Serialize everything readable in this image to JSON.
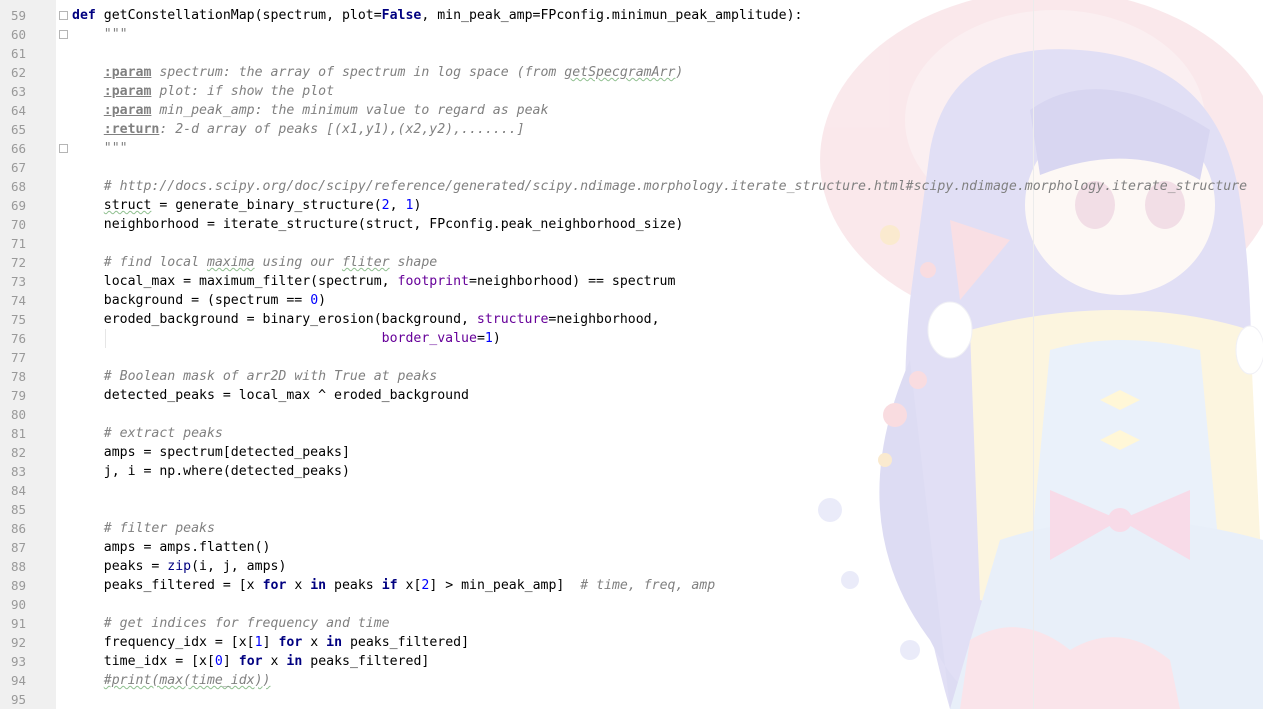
{
  "editor": {
    "line_numbers": [
      "59",
      "60",
      "61",
      "62",
      "63",
      "64",
      "65",
      "66",
      "67",
      "68",
      "69",
      "70",
      "71",
      "72",
      "73",
      "74",
      "75",
      "76",
      "77",
      "78",
      "79",
      "80",
      "81",
      "82",
      "83",
      "84",
      "85",
      "86",
      "87",
      "88",
      "89",
      "90",
      "91",
      "92",
      "93",
      "94",
      "95"
    ],
    "lines": [
      [
        {
          "t": "def",
          "c": "kw"
        },
        {
          "t": " getConstellationMap(spectrum, plot="
        },
        {
          "t": "False",
          "c": "kw"
        },
        {
          "t": ", min_peak_amp=FPconfig.minimun_peak_amplitude):"
        }
      ],
      [
        {
          "t": "    \"\"\"",
          "c": "doc"
        }
      ],
      [],
      [
        {
          "t": "    "
        },
        {
          "t": ":param",
          "c": "tag"
        },
        {
          "t": " spectrum: the array of spectrum in log space (from ",
          "c": "doc"
        },
        {
          "t": "getSpecgramArr",
          "c": "doc squig"
        },
        {
          "t": ")",
          "c": "doc"
        }
      ],
      [
        {
          "t": "    "
        },
        {
          "t": ":param",
          "c": "tag"
        },
        {
          "t": " plot: if show the plot",
          "c": "doc"
        }
      ],
      [
        {
          "t": "    "
        },
        {
          "t": ":param",
          "c": "tag"
        },
        {
          "t": " min_peak_amp: the minimum value to regard as peak",
          "c": "doc"
        }
      ],
      [
        {
          "t": "    "
        },
        {
          "t": ":return",
          "c": "tag"
        },
        {
          "t": ": 2-d array of peaks [(x1,y1),(x2,y2),.......]",
          "c": "doc"
        }
      ],
      [
        {
          "t": "    \"\"\"",
          "c": "doc"
        }
      ],
      [],
      [
        {
          "t": "    "
        },
        {
          "t": "# http://docs.scipy.org/doc/scipy/reference/generated/scipy.ndimage.morphology.iterate_structure.html#scipy.ndimage.morphology.iterate_structure",
          "c": "cm"
        }
      ],
      [
        {
          "t": "    "
        },
        {
          "t": "struct",
          "c": "squig"
        },
        {
          "t": " = generate_binary_structure("
        },
        {
          "t": "2",
          "c": "num"
        },
        {
          "t": ", "
        },
        {
          "t": "1",
          "c": "num"
        },
        {
          "t": ")"
        }
      ],
      [
        {
          "t": "    neighborhood = iterate_structure(struct, FPconfig.peak_neighborhood_size)"
        }
      ],
      [],
      [
        {
          "t": "    "
        },
        {
          "t": "# find local ",
          "c": "cm"
        },
        {
          "t": "maxima",
          "c": "cm squig"
        },
        {
          "t": " using our ",
          "c": "cm"
        },
        {
          "t": "fliter",
          "c": "cm squig"
        },
        {
          "t": " shape",
          "c": "cm"
        }
      ],
      [
        {
          "t": "    local_max = maximum_filter(spectrum, "
        },
        {
          "t": "footprint",
          "c": "kwarg"
        },
        {
          "t": "=neighborhood) == spectrum"
        }
      ],
      [
        {
          "t": "    background = (spectrum == "
        },
        {
          "t": "0",
          "c": "num"
        },
        {
          "t": ")"
        }
      ],
      [
        {
          "t": "    eroded_background = binary_erosion(background, "
        },
        {
          "t": "structure",
          "c": "kwarg"
        },
        {
          "t": "=neighborhood,"
        }
      ],
      [
        {
          "t": "                                       "
        },
        {
          "t": "border_value",
          "c": "kwarg"
        },
        {
          "t": "="
        },
        {
          "t": "1",
          "c": "num"
        },
        {
          "t": ")"
        }
      ],
      [],
      [
        {
          "t": "    "
        },
        {
          "t": "# Boolean mask of arr2D with True at peaks",
          "c": "cm"
        }
      ],
      [
        {
          "t": "    detected_peaks = local_max ^ eroded_background"
        }
      ],
      [],
      [
        {
          "t": "    "
        },
        {
          "t": "# extract peaks",
          "c": "cm"
        }
      ],
      [
        {
          "t": "    amps = spectrum[detected_peaks]"
        }
      ],
      [
        {
          "t": "    j, i = np.where(detected_peaks)"
        }
      ],
      [],
      [],
      [
        {
          "t": "    "
        },
        {
          "t": "# filter peaks",
          "c": "cm"
        }
      ],
      [
        {
          "t": "    amps = amps.flatten()"
        }
      ],
      [
        {
          "t": "    peaks = "
        },
        {
          "t": "zip",
          "c": "bi"
        },
        {
          "t": "(i, j, amps)"
        }
      ],
      [
        {
          "t": "    peaks_filtered = [x "
        },
        {
          "t": "for",
          "c": "kw"
        },
        {
          "t": " x "
        },
        {
          "t": "in",
          "c": "kw"
        },
        {
          "t": " peaks "
        },
        {
          "t": "if",
          "c": "kw"
        },
        {
          "t": " x["
        },
        {
          "t": "2",
          "c": "num"
        },
        {
          "t": "] > min_peak_amp]  "
        },
        {
          "t": "# time, freq, amp",
          "c": "cm"
        }
      ],
      [],
      [
        {
          "t": "    "
        },
        {
          "t": "# get indices for frequency and time",
          "c": "cm"
        }
      ],
      [
        {
          "t": "    frequency_idx = [x["
        },
        {
          "t": "1",
          "c": "num"
        },
        {
          "t": "] "
        },
        {
          "t": "for",
          "c": "kw"
        },
        {
          "t": " x "
        },
        {
          "t": "in",
          "c": "kw"
        },
        {
          "t": " peaks_filtered]"
        }
      ],
      [
        {
          "t": "    time_idx = [x["
        },
        {
          "t": "0",
          "c": "num"
        },
        {
          "t": "] "
        },
        {
          "t": "for",
          "c": "kw"
        },
        {
          "t": " x "
        },
        {
          "t": "in",
          "c": "kw"
        },
        {
          "t": " peaks_filtered]"
        }
      ],
      [
        {
          "t": "    "
        },
        {
          "t": "#print(max(time_idx))",
          "c": "cm squig"
        }
      ],
      []
    ]
  },
  "colors": {
    "keyword": "#000080",
    "number": "#0000ff",
    "comment": "#808080",
    "kwarg": "#660099",
    "gutter_bg": "#f0f0f0"
  },
  "icons": [
    "fold-marker-icon"
  ]
}
